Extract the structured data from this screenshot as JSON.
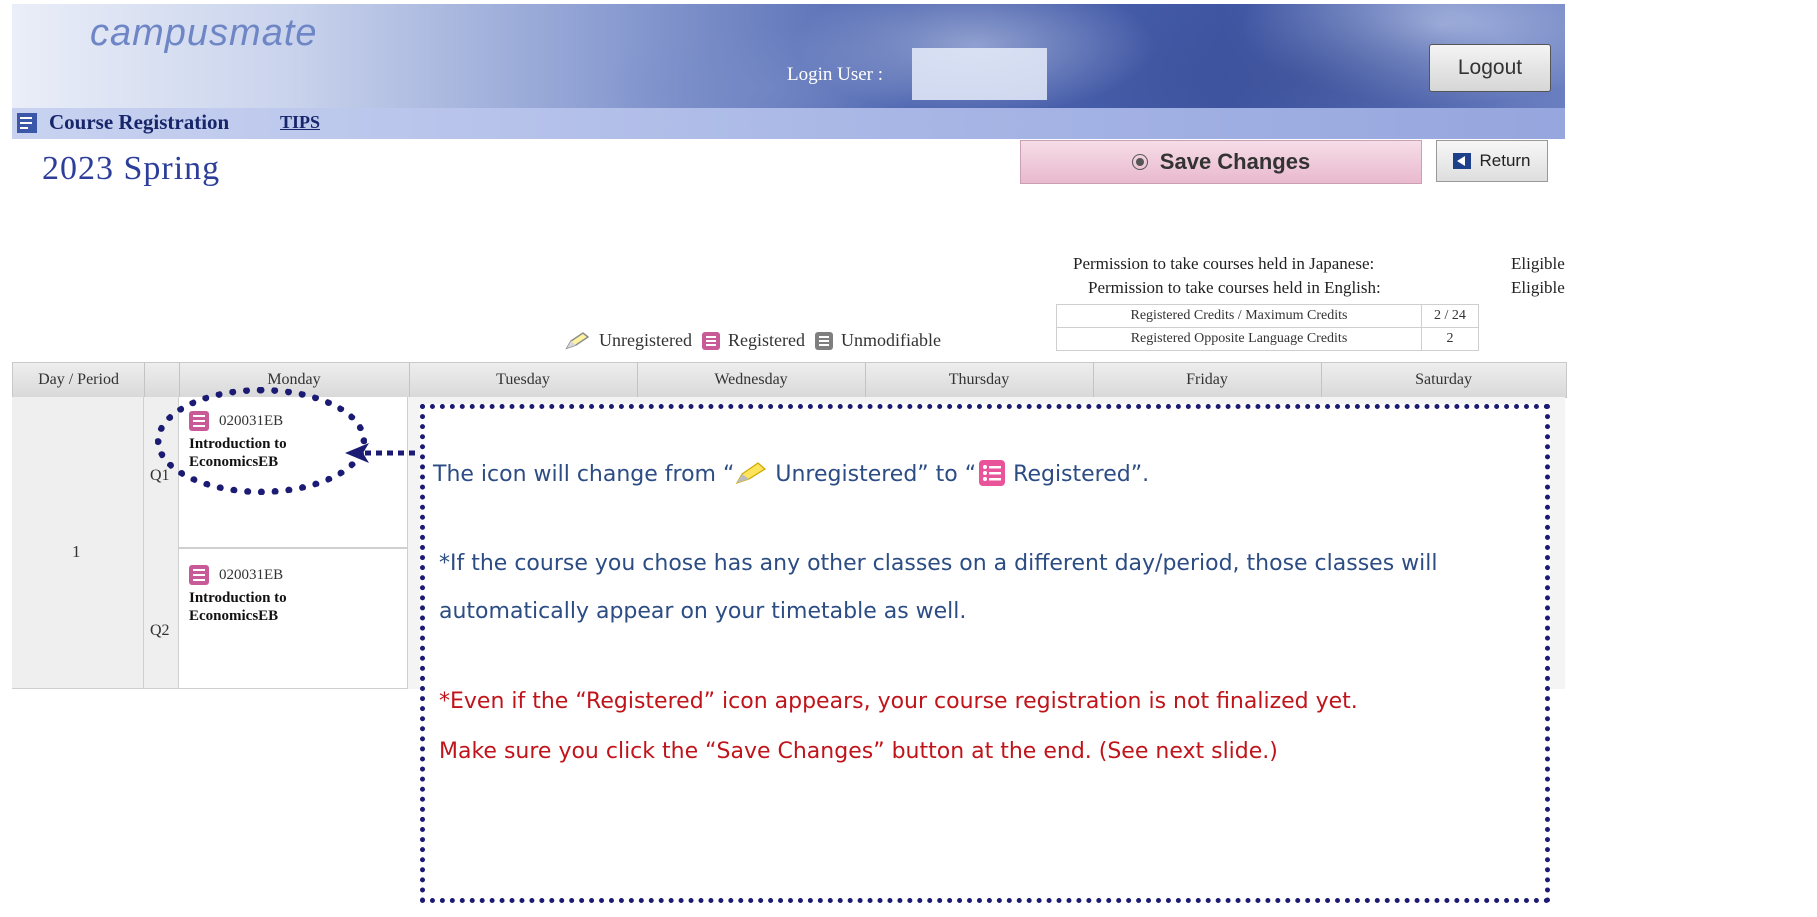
{
  "header": {
    "logo_text": "campusmate",
    "login_label": "Login User :",
    "logout_label": "Logout"
  },
  "titlebar": {
    "title": "Course Registration",
    "tips_label": "TIPS"
  },
  "term": "2023 Spring",
  "actions": {
    "save_label": "Save Changes",
    "return_label": "Return"
  },
  "permissions": [
    {
      "label": "Permission to take courses held in Japanese:",
      "value": "Eligible"
    },
    {
      "label": "Permission to take courses held in English:",
      "value": "Eligible"
    }
  ],
  "credits": [
    {
      "label": "Registered Credits / Maximum Credits",
      "value": "2 / 24"
    },
    {
      "label": "Registered Opposite Language Credits",
      "value": "2"
    }
  ],
  "legend": {
    "unregistered": "Unregistered",
    "registered": "Registered",
    "unmodifiable": "Unmodifiable"
  },
  "timetable": {
    "day_period_header": "Day / Period",
    "days": [
      "Monday",
      "Tuesday",
      "Wednesday",
      "Thursday",
      "Friday",
      "Saturday"
    ],
    "period": "1",
    "quarters": [
      "Q1",
      "Q2"
    ],
    "courses": [
      {
        "code": "020031EB",
        "name": "Introduction to EconomicsEB"
      },
      {
        "code": "020031EB",
        "name": "Introduction to EconomicsEB"
      }
    ]
  },
  "callout": {
    "line1_a": "The icon will change from “",
    "line1_b": " Unregistered” to “",
    "line1_c": " Registered”.",
    "line2": "*If the course you chose has any other classes on a different day/period, those classes will",
    "line3": "automatically appear on your timetable as well.",
    "line4": "*Even if the “Registered” icon appears, your course registration is not finalized yet.",
    "line5": " Make sure you click the “Save Changes” button at the end. (See next slide.)"
  },
  "colors": {
    "registered_icon": "#c85a98",
    "unmodifiable_icon": "#7f7f7f",
    "callout_border": "#1c1b73",
    "callout_text": "#2c4c84",
    "warning_text": "#c0141b"
  }
}
